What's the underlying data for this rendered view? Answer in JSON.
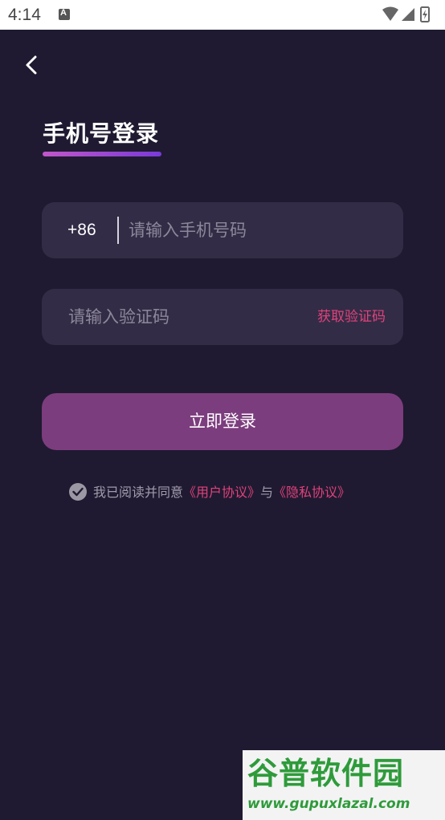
{
  "status_bar": {
    "time": "4:14",
    "notification_icon": "text-a-icon",
    "icons": [
      "wifi-icon",
      "cell-signal-icon",
      "battery-charging-icon"
    ]
  },
  "header": {
    "back_icon": "chevron-left-icon",
    "title": "手机号登录"
  },
  "phone_field": {
    "country_code": "+86",
    "placeholder": "请输入手机号码",
    "value": ""
  },
  "code_field": {
    "placeholder": "请输入验证码",
    "value": "",
    "get_code_label": "获取验证码"
  },
  "login_button": {
    "label": "立即登录"
  },
  "agreement": {
    "checked": true,
    "prefix": "我已阅读并同意",
    "user_agreement": "《用户协议》",
    "connector": "与",
    "privacy_policy": "《隐私协议》"
  },
  "watermark": {
    "brand": "谷普软件园",
    "url": "www.gupuxlazal.com"
  },
  "colors": {
    "background": "#1f1a31",
    "input_bg": "#332c46",
    "accent_pink": "#e0427b",
    "button_purple": "#7c3d7e",
    "title_gradient_start": "#c156c9",
    "title_gradient_end": "#7a3ad9"
  }
}
